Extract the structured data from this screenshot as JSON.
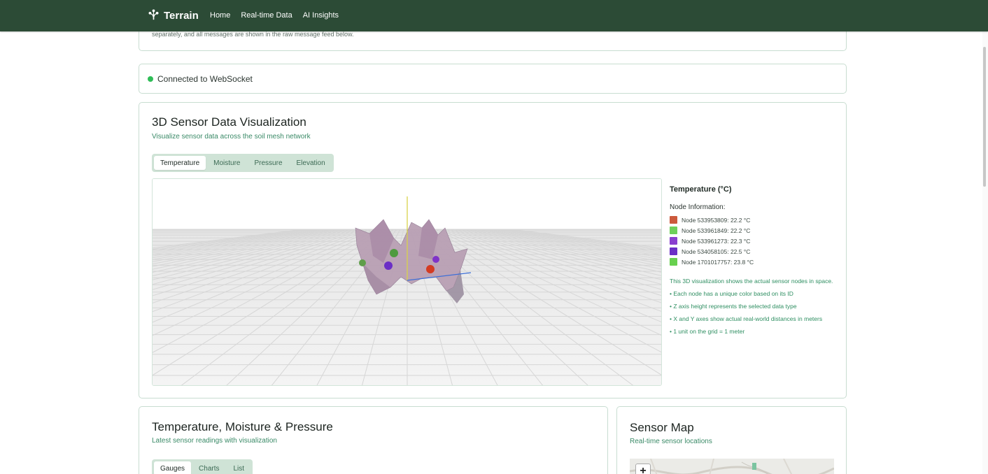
{
  "nav": {
    "brand": "Terrain",
    "links": [
      "Home",
      "Real-time Data",
      "AI Insights"
    ]
  },
  "top_card": {
    "clipped_text": "separately, and all messages are shown in the raw message feed below."
  },
  "status": {
    "text": "Connected to WebSocket",
    "color": "#2fbd57"
  },
  "viz3d": {
    "title": "3D Sensor Data Visualization",
    "subtitle": "Visualize sensor data across the soil mesh network",
    "tabs": [
      "Temperature",
      "Moisture",
      "Pressure",
      "Elevation"
    ],
    "active_tab": "Temperature",
    "legend_title": "Temperature (°C)",
    "node_info_title": "Node Information:",
    "nodes": [
      {
        "label": "Node 533953809: 22.2 °C",
        "color": "#cc5a3d"
      },
      {
        "label": "Node 533961849: 22.2 °C",
        "color": "#6fd05a"
      },
      {
        "label": "Node 533961273: 22.3 °C",
        "color": "#8a3fcf"
      },
      {
        "label": "Node 534058105: 22.5 °C",
        "color": "#6b2fc6"
      },
      {
        "label": "Node 1701017757: 23.8 °C",
        "color": "#67d04e"
      }
    ],
    "description": "This 3D visualization shows the actual sensor nodes in space.",
    "bullets": [
      "• Each node has a unique color based on its ID",
      "• Z axis height represents the selected data type",
      "• X and Y axes show actual real-world distances in meters",
      "• 1 unit on the grid = 1 meter"
    ]
  },
  "tmp_card": {
    "title": "Temperature, Moisture & Pressure",
    "subtitle": "Latest sensor readings with visualization",
    "tabs": [
      "Gauges",
      "Charts",
      "List"
    ],
    "active_tab": "Gauges"
  },
  "map_card": {
    "title": "Sensor Map",
    "subtitle": "Real-time sensor locations",
    "zoom_in": "+"
  }
}
